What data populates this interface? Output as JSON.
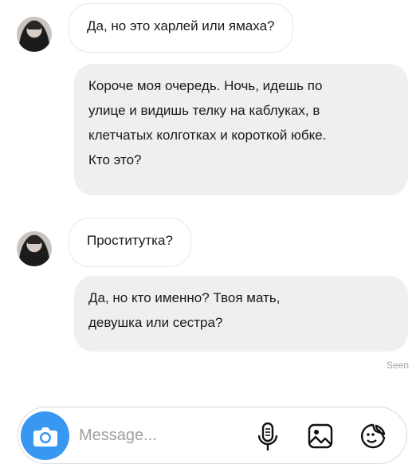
{
  "messages": [
    {
      "from": "them",
      "text": "Да, но это харлей или ямаха?"
    },
    {
      "from": "me",
      "lines": [
        "Короче моя очередь. Ночь, идешь по",
        "улице и видишь телку на каблуках, в",
        "клетчатых колготках и короткой юбке.",
        "Кто это?"
      ]
    },
    {
      "from": "them",
      "text": "Проститутка?"
    },
    {
      "from": "me",
      "lines": [
        "Да, но кто именно? Твоя мать,",
        "девушка или сестра?"
      ]
    }
  ],
  "status": {
    "seen": "Seen"
  },
  "composer": {
    "placeholder": "Message..."
  },
  "colors": {
    "accent": "#3897f0",
    "outgoing_bubble": "#efefef",
    "incoming_border": "#e7e7e7"
  },
  "icons": [
    "camera-icon",
    "microphone-icon",
    "gallery-icon",
    "sticker-icon"
  ]
}
